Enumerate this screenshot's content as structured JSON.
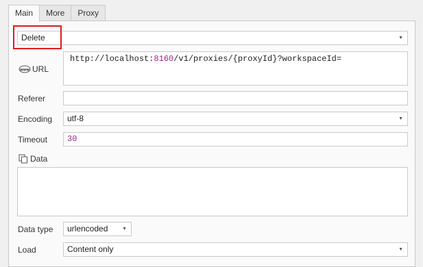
{
  "tabs": [
    {
      "label": "Main",
      "active": true
    },
    {
      "label": "More",
      "active": false
    },
    {
      "label": "Proxy",
      "active": false
    }
  ],
  "method": {
    "value": "Delete"
  },
  "url": {
    "label": "URL",
    "value_prefix": "http://localhost:",
    "value_port": "8160",
    "value_suffix": "/v1/proxies/{proxyId}?workspaceId="
  },
  "referer": {
    "label": "Referer",
    "value": ""
  },
  "encoding": {
    "label": "Encoding",
    "value": "utf-8"
  },
  "timeout": {
    "label": "Timeout",
    "value": "30"
  },
  "data": {
    "label": "Data",
    "value": ""
  },
  "data_type": {
    "label": "Data type",
    "value": "urlencoded"
  },
  "load": {
    "label": "Load",
    "value": "Content only"
  },
  "colors": {
    "highlight": "#e0191e",
    "number": "#a0238c"
  },
  "icons": {
    "url": "www-globe-icon",
    "data": "copy-pages-icon",
    "dropdown": "chevron-down-icon"
  }
}
